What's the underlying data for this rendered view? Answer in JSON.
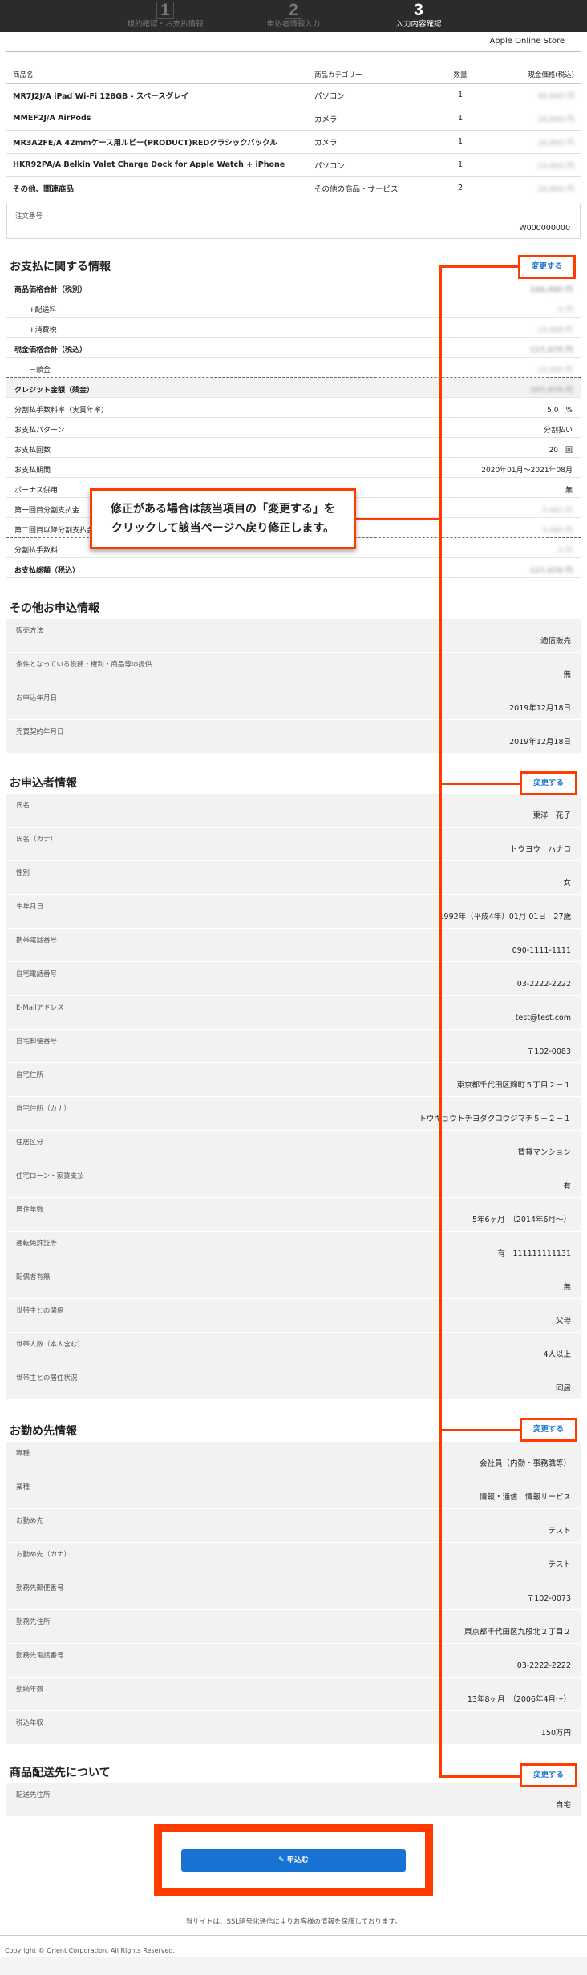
{
  "steps": [
    {
      "num": "1",
      "label": "規約確認・お支払情報"
    },
    {
      "num": "2",
      "label": "申込者情報入力"
    },
    {
      "num": "3",
      "label": "入力内容確認"
    }
  ],
  "store_name": "Apple Online Store",
  "products": {
    "headers": {
      "name": "商品名",
      "category": "商品カテゴリー",
      "qty": "数量",
      "price": "現金価格(税込)"
    },
    "rows": [
      {
        "name": "MR7J2J/A iPad Wi-Fi 128GB - スペースグレイ",
        "category": "パソコン",
        "qty": "1",
        "price": "48,800 円"
      },
      {
        "name": "MMEF2J/A AirPods",
        "category": "カメラ",
        "qty": "1",
        "price": "16,800 円"
      },
      {
        "name": "MR3A2FE/A 42mmケース用ルビー(PRODUCT)REDクラシックバックル",
        "category": "カメラ",
        "qty": "1",
        "price": "16,800 円"
      },
      {
        "name": "HKR92PA/A Belkin Valet Charge Dock for Apple Watch + iPhone",
        "category": "パソコン",
        "qty": "1",
        "price": "14,800 円"
      },
      {
        "name": "その他、関連商品",
        "category": "その他の商品・サービス",
        "qty": "2",
        "price": "16,800 円"
      }
    ]
  },
  "order": {
    "label": "注文番号",
    "value": "W000000000"
  },
  "change_label": "変更する",
  "payment": {
    "title": "お支払に関する情報",
    "rows": [
      {
        "k": "商品価格合計（税別）",
        "v": "106,980 円",
        "blur": true,
        "style": "bold"
      },
      {
        "k": "+配送料",
        "v": "0 円",
        "blur": true,
        "style": "indent"
      },
      {
        "k": "+消費税",
        "v": "10,698 円",
        "blur": true,
        "style": "indent"
      },
      {
        "k": "現金価格合計（税込）",
        "v": "117,678 円",
        "blur": true,
        "style": "bold"
      },
      {
        "k": "－頭金",
        "v": "10,000 円",
        "blur": true,
        "style": "indent"
      },
      {
        "k": "クレジット金額（残金）",
        "v": "107,678 円",
        "blur": true,
        "style": "boldshade"
      },
      {
        "k": "分割払手数料率（実質年率）",
        "v": "5.0　%",
        "blur": false,
        "style": ""
      },
      {
        "k": "お支払パターン",
        "v": "分割払い",
        "blur": false,
        "style": ""
      },
      {
        "k": "お支払回数",
        "v": "20　回",
        "blur": false,
        "style": ""
      },
      {
        "k": "お支払期間",
        "v": "2020年01月～2021年08月",
        "blur": false,
        "style": ""
      },
      {
        "k": "ボーナス併用",
        "v": "無",
        "blur": false,
        "style": ""
      },
      {
        "k": "第一回目分割支払金",
        "v": "5,481 円",
        "blur": true,
        "style": ""
      },
      {
        "k": "第二回目以降分割支払金",
        "v": "5,480 円",
        "blur": true,
        "style": "dotted"
      },
      {
        "k": "分割払手数料",
        "v": "0 円",
        "blur": true,
        "style": ""
      },
      {
        "k": "お支払総額（税込）",
        "v": "117,678 円",
        "blur": true,
        "style": "bold"
      }
    ]
  },
  "callout": {
    "line1": "修正がある場合は該当項目の「変更する」を",
    "line2": "クリックして該当ページへ戻り修正します。"
  },
  "other": {
    "title": "その他お申込情報",
    "rows": [
      {
        "k": "販売方法",
        "v": "通信販売"
      },
      {
        "k": "条件となっている役務・権利・商品等の提供",
        "v": "無"
      },
      {
        "k": "お申込年月日",
        "v": "2019年12月18日"
      },
      {
        "k": "売買契約年月日",
        "v": "2019年12月18日"
      }
    ]
  },
  "applicant": {
    "title": "お申込者情報",
    "rows": [
      {
        "k": "氏名",
        "v": "東洋　花子"
      },
      {
        "k": "氏名（カナ）",
        "v": "トウヨウ　ハナコ"
      },
      {
        "k": "性別",
        "v": "女"
      },
      {
        "k": "生年月日",
        "v": "1992年（平成4年）01月 01日　27歳"
      },
      {
        "k": "携帯電話番号",
        "v": "090-1111-1111"
      },
      {
        "k": "自宅電話番号",
        "v": "03-2222-2222"
      },
      {
        "k": "E-Mailアドレス",
        "v": "test@test.com"
      },
      {
        "k": "自宅郵便番号",
        "v": "〒102-0083"
      },
      {
        "k": "自宅住所",
        "v": "東京都千代田区麹町５丁目２－１"
      },
      {
        "k": "自宅住所（カナ）",
        "v": "トウキョウトチヨダクコウジマチ５－２－１"
      },
      {
        "k": "住居区分",
        "v": "賃貸マンション"
      },
      {
        "k": "住宅ローン・家賃支払",
        "v": "有"
      },
      {
        "k": "居住年数",
        "v": "5年6ヶ月　（2014年6月～）"
      },
      {
        "k": "運転免許証等",
        "v": "有　111111111131"
      },
      {
        "k": "配偶者有無",
        "v": "無"
      },
      {
        "k": "世帯主との関係",
        "v": "父母"
      },
      {
        "k": "世帯人数（本人含む）",
        "v": "4人以上"
      },
      {
        "k": "世帯主との居住状況",
        "v": "同居"
      }
    ]
  },
  "work": {
    "title": "お勤め先情報",
    "rows": [
      {
        "k": "職種",
        "v": "会社員（内勤・事務職等）"
      },
      {
        "k": "業種",
        "v": "情報・通信　情報サービス"
      },
      {
        "k": "お勤め先",
        "v": "テスト"
      },
      {
        "k": "お勤め先（カナ）",
        "v": "テスト"
      },
      {
        "k": "勤務先郵便番号",
        "v": "〒102-0073"
      },
      {
        "k": "勤務先住所",
        "v": "東京都千代田区九段北２丁目２"
      },
      {
        "k": "勤務先電話番号",
        "v": "03-2222-2222"
      },
      {
        "k": "勤続年数",
        "v": "13年8ヶ月　（2006年4月～）"
      },
      {
        "k": "税込年収",
        "v": "150万円"
      }
    ]
  },
  "delivery": {
    "title": "商品配送先について",
    "rows": [
      {
        "k": "配送先住所",
        "v": "自宅"
      }
    ]
  },
  "submit_label": "申込む",
  "ssl_note": "当サイトは、SSL暗号化通信によりお客様の情報を保護しております。",
  "copyright": "Copyright © Orient Corporation. All Rights Reserved.",
  "colors": {
    "accent": "#ff3b00",
    "link": "#1673d4"
  }
}
